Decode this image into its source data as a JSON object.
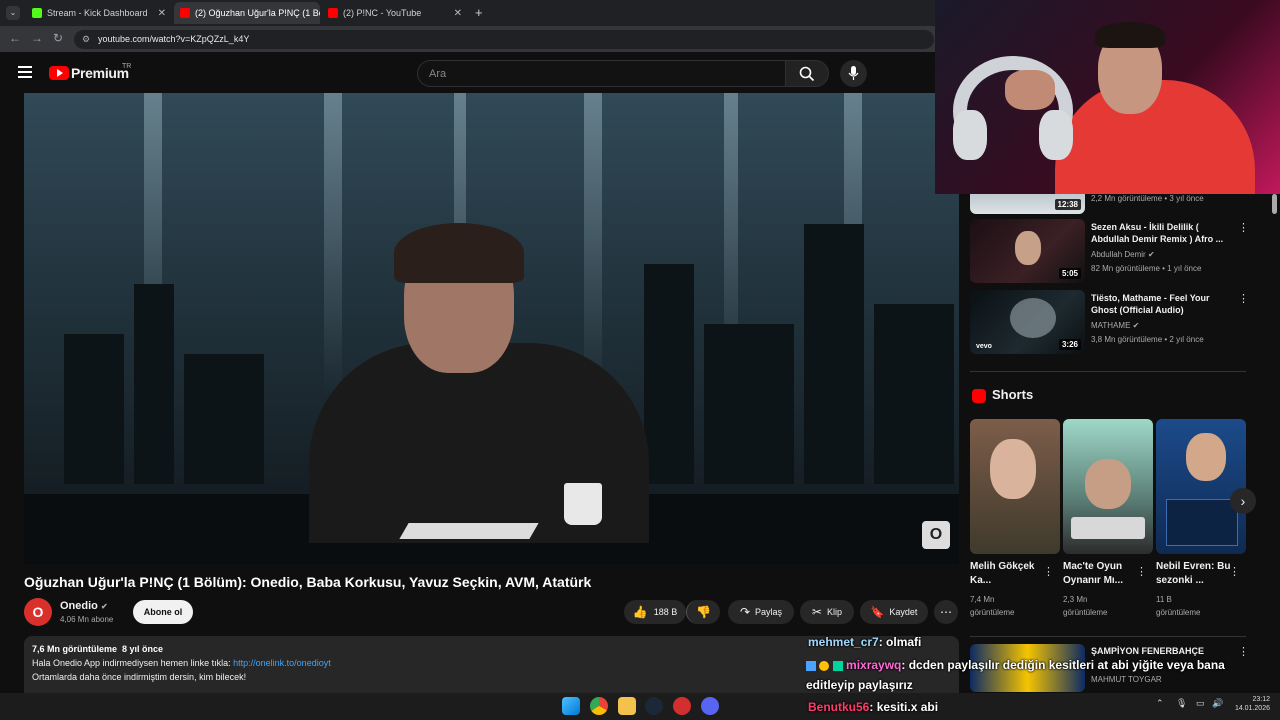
{
  "browser": {
    "tabs": [
      {
        "label": "Stream - Kick Dashboard",
        "active": false,
        "favicon_color": "#53fc18"
      },
      {
        "label": "(2) Oğuzhan Uğur'la P!NÇ (1 Bö",
        "active": true,
        "favicon_color": "#ff0000"
      },
      {
        "label": "(2) P!NC - YouTube",
        "active": false,
        "favicon_color": "#ff0000"
      }
    ],
    "close_glyph": "✕",
    "new_tab_glyph": "+",
    "url": "youtube.com/watch?v=KZpQZzL_k4Y"
  },
  "youtube": {
    "logo_text": "Premium",
    "region": "TR",
    "search_placeholder": "Ara"
  },
  "video": {
    "title": "Oğuzhan Uğur'la P!NÇ (1 Bölüm): Onedio, Baba Korkusu, Yavuz Seçkin, AVM, Atatürk",
    "channel": "Onedio",
    "subscribers": "4,06 Mn abone",
    "subscribe_label": "Abone ol",
    "likes": "188 B",
    "share_label": "Paylaş",
    "clip_label": "Klip",
    "save_label": "Kaydet",
    "views": "7,6 Mn görüntüleme",
    "age": "8 yıl önce",
    "desc_line1": "Hala Onedio App indirmediysen hemen linke tıkla:",
    "desc_link": "http://onelink.to/onedioyt",
    "desc_line2": "Ortamlarda daha önce indirmiştim dersin, kim bilecek!"
  },
  "recommendations": [
    {
      "title": "",
      "channel": "",
      "meta": "2,2 Mn görüntüleme • 3 yıl önce",
      "duration": "12:38"
    },
    {
      "title": "Sezen Aksu - İkili Delilik ( Abdullah Demir Remix ) Afro ...",
      "channel": "Abdullah Demir",
      "meta": "82 Mn görüntüleme • 1 yıl önce",
      "duration": "5:05"
    },
    {
      "title": "Tiësto, Mathame - Feel Your Ghost (Official Audio)",
      "channel": "MATHAME",
      "meta": "3,8 Mn görüntüleme • 2 yıl önce",
      "duration": "3:26"
    }
  ],
  "shorts": {
    "heading": "Shorts",
    "items": [
      {
        "title": "Melih Gökçek Ka...",
        "views": "7,4 Mn",
        "views_label": "görüntüleme"
      },
      {
        "title": "Mac'te Oyun Oynanır Mı...",
        "views": "2,3 Mn",
        "views_label": "görüntüleme"
      },
      {
        "title": "Nebil Evren: Bu sezonki ...",
        "views": "11 B",
        "views_label": "görüntüleme"
      }
    ],
    "next_title": "ŞAMPİYON FENERBAHÇE",
    "next_channel": "MAHMUT TOYGAR"
  },
  "chat": [
    {
      "user": "mehmet_cr7",
      "text": ": olmafi",
      "color": "#9fd9ff"
    },
    {
      "user": "mixraywq",
      "text": ": dcden paylaşılır dediğin kesitleri at abi yiğite veya bana",
      "color": "#ff6bd6"
    },
    {
      "user": "",
      "text": "editleyip paylaşırız",
      "color": "#ffffff"
    },
    {
      "user": "Benutku56",
      "text": ": kesiti.x abi",
      "color": "#ff3b6b"
    }
  ],
  "taskbar": {
    "time": "23:12",
    "date": "14.01.2026"
  }
}
